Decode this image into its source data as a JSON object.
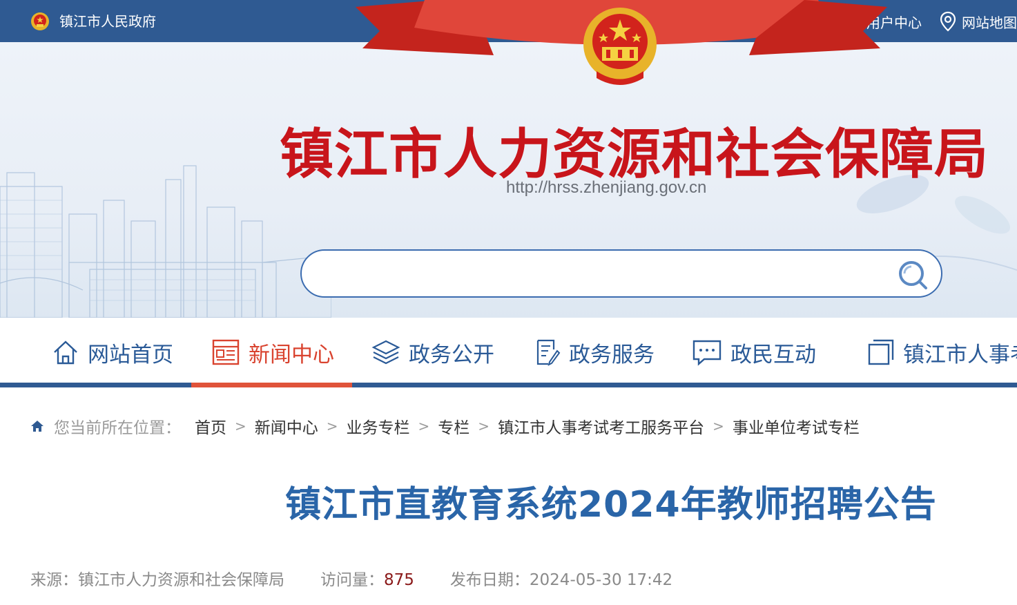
{
  "topbar": {
    "gov_link": "镇江市人民政府",
    "user_center": "用户中心",
    "site_map": "网站地图"
  },
  "header": {
    "title": "镇江市人力资源和社会保障局",
    "url": "http://hrss.zhenjiang.gov.cn"
  },
  "search": {
    "placeholder": ""
  },
  "nav": {
    "items": [
      {
        "label": "网站首页"
      },
      {
        "label": "新闻中心"
      },
      {
        "label": "政务公开"
      },
      {
        "label": "政务服务"
      },
      {
        "label": "政民互动"
      },
      {
        "label": "镇江市人事考"
      }
    ]
  },
  "breadcrumb": {
    "prefix": "您当前所在位置：",
    "items": [
      "首页",
      "新闻中心",
      "业务专栏",
      "专栏",
      "镇江市人事考试考工服务平台",
      "事业单位考试专栏"
    ],
    "separator": ">"
  },
  "article": {
    "title": "镇江市直教育系统2024年教师招聘公告",
    "source_label": "来源：",
    "source": "镇江市人力资源和社会保障局",
    "views_label": "访问量：",
    "views": "875",
    "date_label": "发布日期：",
    "date": "2024-05-30 17:42"
  },
  "colors": {
    "topbar": "#2f5a92",
    "title_red": "#c8151b",
    "nav_blue": "#2a5a97",
    "nav_active": "#e0533a",
    "article_title": "#2a65a8"
  }
}
